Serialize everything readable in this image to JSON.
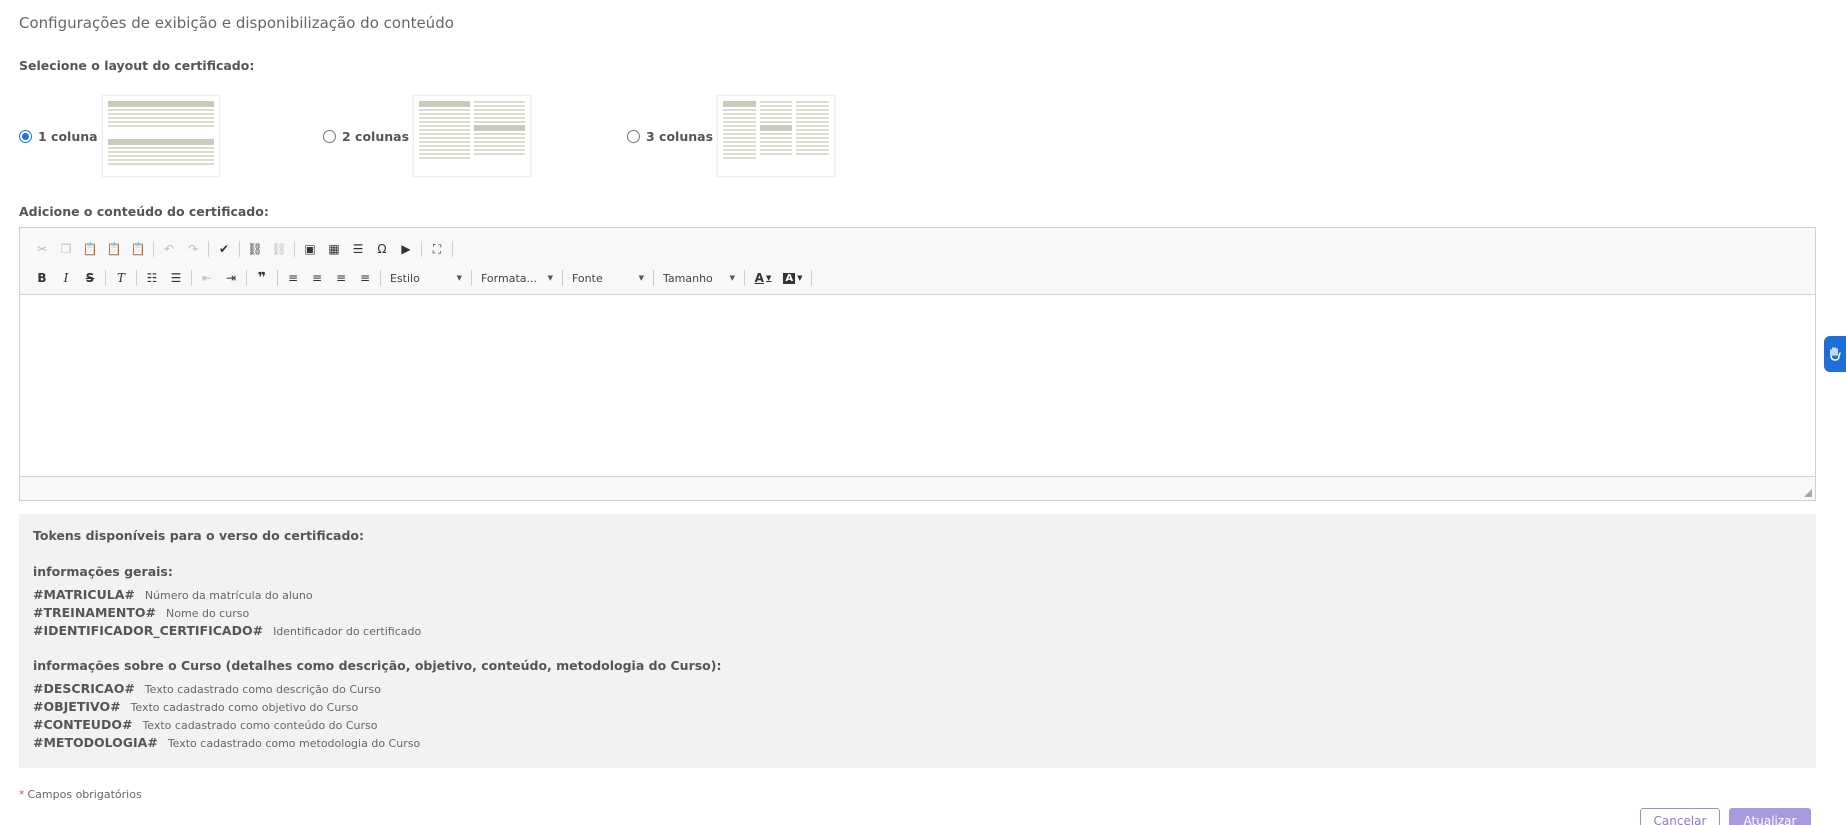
{
  "section_title": "Configurações de exibição e disponibilização do conteúdo",
  "layout": {
    "label": "Selecione o layout do certificado:",
    "options": [
      {
        "label": "1 coluna",
        "selected": true
      },
      {
        "label": "2 colunas",
        "selected": false
      },
      {
        "label": "3 colunas",
        "selected": false
      }
    ]
  },
  "content": {
    "label": "Adicione o conteúdo do certificado:"
  },
  "editor": {
    "combos": {
      "style": "Estilo",
      "format": "Formata...",
      "font": "Fonte",
      "size": "Tamanho"
    },
    "icons": {
      "special_char": "Ω"
    }
  },
  "tokens": {
    "title": "Tokens disponíveis para o verso do certificado:",
    "general_heading": "informações gerais:",
    "general": [
      {
        "code": "#MATRICULA#",
        "desc": "Número da matrícula do aluno"
      },
      {
        "code": "#TREINAMENTO#",
        "desc": "Nome do curso"
      },
      {
        "code": "#IDENTIFICADOR_CERTIFICADO#",
        "desc": "Identificador do certificado"
      }
    ],
    "course_heading": "informações sobre o Curso (detalhes como descrição, objetivo, conteúdo, metodologia do Curso):",
    "course": [
      {
        "code": "#DESCRICAO#",
        "desc": "Texto cadastrado como descrição do Curso"
      },
      {
        "code": "#OBJETIVO#",
        "desc": "Texto cadastrado como objetivo do Curso"
      },
      {
        "code": "#CONTEUDO#",
        "desc": "Texto cadastrado como conteúdo do Curso"
      },
      {
        "code": "#METODOLOGIA#",
        "desc": "Texto cadastrado como metodologia do Curso"
      }
    ]
  },
  "required_note": {
    "star": "*",
    "text": "Campos obrigatórios"
  },
  "buttons": {
    "cancel": "Cancelar",
    "update": "Atualizar"
  },
  "colors": {
    "accent": "#8e7cc3",
    "update_bg": "#a99ae0",
    "radio_selected": "#1a73e8",
    "side_tab": "#1e6fd9",
    "required_star": "#d9534f"
  }
}
